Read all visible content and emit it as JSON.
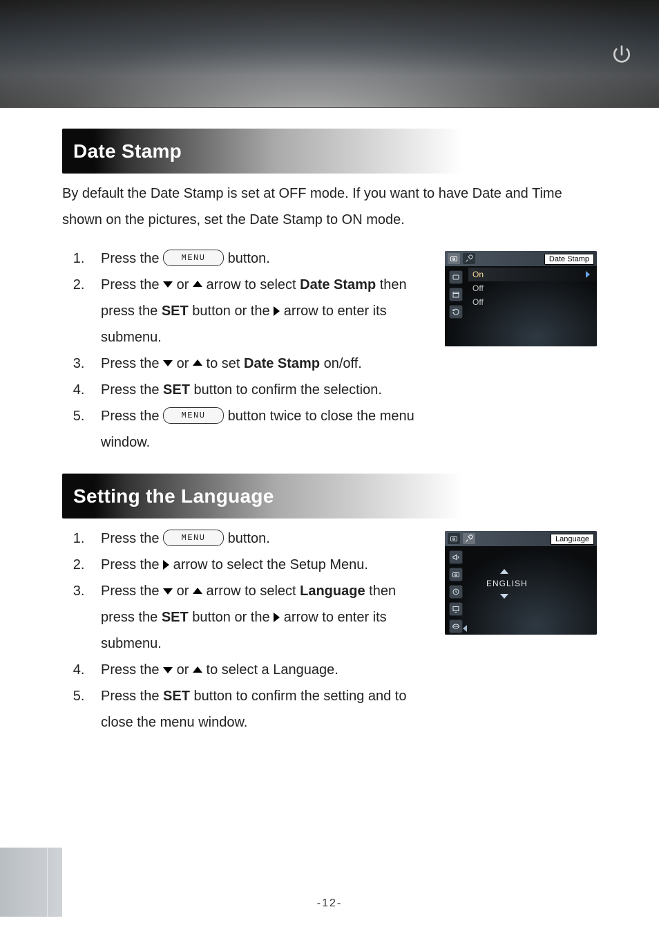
{
  "section1": {
    "title": "Date Stamp",
    "intro": "By default the Date Stamp is set at OFF mode. If you want to have Date and Time shown on the pictures, set the Date Stamp to ON mode.",
    "steps": {
      "s1a": "Press the ",
      "s1b": " button.",
      "s2a": "Press the ",
      "s2b": " or ",
      "s2c": " arrow to select ",
      "s2d_bold": "Date Stamp",
      "s2e": " then press the ",
      "s2f_bold": "SET",
      "s2g": " button or the ",
      "s2h": " arrow to enter its submenu.",
      "s3a": "Press the ",
      "s3b": " or ",
      "s3c": " to set ",
      "s3d_bold": "Date Stamp",
      "s3e": " on/off.",
      "s4a": "Press the ",
      "s4b_bold": "SET",
      "s4c": " button to confirm the selection.",
      "s5a": "Press the ",
      "s5b": " button twice to close the menu window."
    }
  },
  "section2": {
    "title": "Setting the Language",
    "steps": {
      "s1a": "Press the ",
      "s1b": " button.",
      "s2a": "Press the ",
      "s2b": " arrow to select the Setup Menu.",
      "s3a": "Press the ",
      "s3b": " or ",
      "s3c": " arrow to select ",
      "s3d_bold": "Language",
      "s3e": " then press the ",
      "s3f_bold": "SET",
      "s3g": " button or the ",
      "s3h": " arrow to enter its submenu.",
      "s4a": "Press the ",
      "s4b": " or ",
      "s4c": " to select a Language.",
      "s5a": "Press the ",
      "s5b_bold": "SET",
      "s5c": " button to confirm the setting and to close the menu window."
    }
  },
  "menu_button_label": "MENU",
  "shot1": {
    "title": "Date Stamp",
    "rows": [
      "On",
      "Off",
      "Off"
    ]
  },
  "shot2": {
    "title": "Language",
    "value": "ENGLISH"
  },
  "page_number": "-12-"
}
